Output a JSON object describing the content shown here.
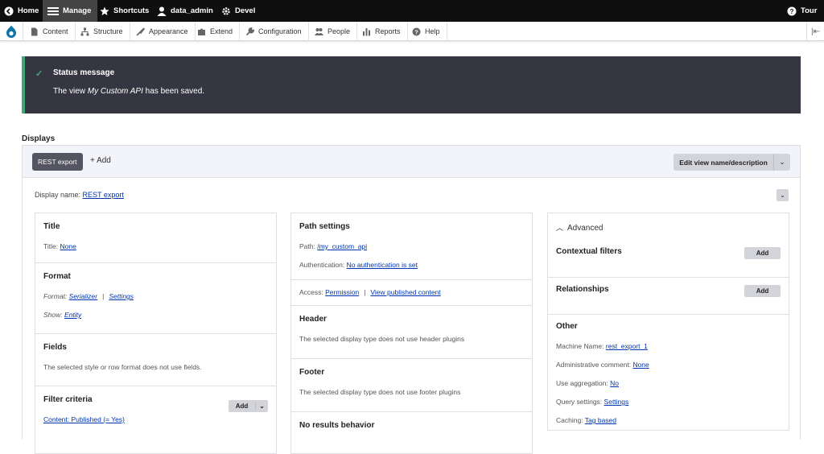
{
  "toolbar": {
    "home": "Home",
    "manage": "Manage",
    "shortcuts": "Shortcuts",
    "user": "data_admin",
    "devel": "Devel",
    "tour": "Tour"
  },
  "admin_menu": {
    "items": [
      "Content",
      "Structure",
      "Appearance",
      "Extend",
      "Configuration",
      "People",
      "Reports",
      "Help"
    ]
  },
  "status": {
    "title": "Status message",
    "msg_before": "The view ",
    "msg_view": "My Custom API",
    "msg_after": " has been saved."
  },
  "displays": {
    "label": "Displays",
    "current": "REST export",
    "add": "+ Add",
    "edit": "Edit view name/description"
  },
  "display_name": {
    "label": "Display name:",
    "value": "REST export"
  },
  "left": {
    "title": {
      "heading": "Title",
      "label": "Title:",
      "value": "None"
    },
    "format": {
      "heading": "Format",
      "format_label": "Format:",
      "format_value": "Serializer",
      "settings": "Settings",
      "show_label": "Show:",
      "show_value": "Entity"
    },
    "fields": {
      "heading": "Fields",
      "text": "The selected style or row format does not use fields."
    },
    "filter": {
      "heading": "Filter criteria",
      "add": "Add",
      "item": "Content: Published (= Yes)"
    }
  },
  "middle": {
    "path": {
      "heading": "Path settings",
      "path_label": "Path:",
      "path_value": "/my_custom_api",
      "auth_label": "Authentication:",
      "auth_value": "No authentication is set"
    },
    "access": {
      "label": "Access:",
      "permission": "Permission",
      "perm_value": "View published content"
    },
    "header": {
      "heading": "Header",
      "text": "The selected display type does not use header plugins"
    },
    "footer": {
      "heading": "Footer",
      "text": "The selected display type does not use footer plugins"
    },
    "noresults": {
      "heading": "No results behavior"
    }
  },
  "right": {
    "advanced": "Advanced",
    "contextual": {
      "heading": "Contextual filters",
      "add": "Add"
    },
    "relationships": {
      "heading": "Relationships",
      "add": "Add"
    },
    "other": {
      "heading": "Other",
      "machine_label": "Machine Name:",
      "machine_value": "rest_export_1",
      "admin_label": "Administrative comment:",
      "admin_value": "None",
      "agg_label": "Use aggregation:",
      "agg_value": "No",
      "query_label": "Query settings:",
      "query_value": "Settings",
      "cache_label": "Caching:",
      "cache_value": "Tag based"
    }
  }
}
